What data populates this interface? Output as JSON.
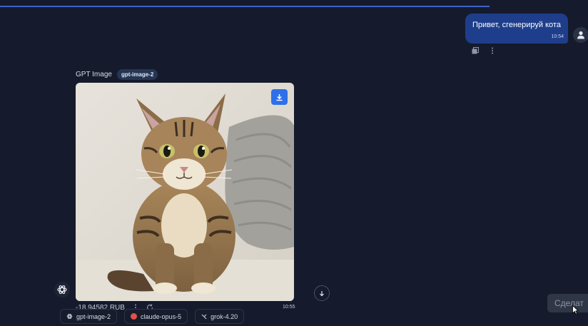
{
  "user_message": {
    "text": "Привет, сгенерируй кота",
    "time": "10:54"
  },
  "assistant": {
    "model_name": "GPT Image",
    "model_badge": "gpt-image-2",
    "image_alt": "tabby cat",
    "price": "-18.94582 RUB",
    "time": "10:55"
  },
  "model_chips": [
    {
      "label": "gpt-image-2",
      "icon": "openai-icon"
    },
    {
      "label": "claude-opus-5",
      "icon": "anthropic-icon",
      "color": "#e0524a"
    },
    {
      "label": "grok-4.20",
      "icon": "xai-icon"
    }
  ],
  "send_button": {
    "label": "Сделат"
  },
  "colors": {
    "background": "#151b2c",
    "user_bubble": "#1e3e8c",
    "accent": "#2f6fea",
    "progress": "#3d63c9"
  }
}
